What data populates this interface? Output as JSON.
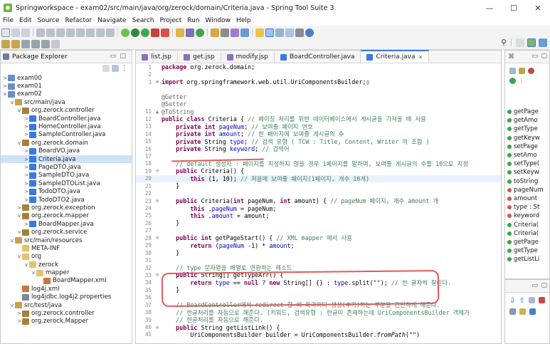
{
  "window": {
    "title": "Springworkspace - exam02/src/main/java/org/zerock/domain/Criteria.java - Spring Tool Suite 3",
    "controls": [
      "—",
      "☐",
      "✕"
    ]
  },
  "menu": [
    "File",
    "Edit",
    "Source",
    "Refactor",
    "Navigate",
    "Search",
    "Project",
    "Run",
    "Window",
    "Help"
  ],
  "package_explorer": {
    "title": "Package Explorer",
    "tree": [
      {
        "indent": 0,
        "twisty": ">",
        "icon": "project",
        "label": "exam00"
      },
      {
        "indent": 0,
        "twisty": ">",
        "icon": "project",
        "label": "exam01"
      },
      {
        "indent": 0,
        "twisty": "v",
        "icon": "project",
        "label": "exam02"
      },
      {
        "indent": 1,
        "twisty": "v",
        "icon": "srcfolder",
        "label": "src/main/java"
      },
      {
        "indent": 2,
        "twisty": "v",
        "icon": "package",
        "label": "org.zerock.controller"
      },
      {
        "indent": 3,
        "twisty": ">",
        "icon": "java",
        "label": "BoardController.java"
      },
      {
        "indent": 3,
        "twisty": ">",
        "icon": "java",
        "label": "HomeController.java"
      },
      {
        "indent": 3,
        "twisty": ">",
        "icon": "java",
        "label": "SampleController.java"
      },
      {
        "indent": 2,
        "twisty": "v",
        "icon": "package",
        "label": "org.zerock.domain"
      },
      {
        "indent": 3,
        "twisty": ">",
        "icon": "java",
        "label": "BoardVO.java"
      },
      {
        "indent": 3,
        "twisty": ">",
        "icon": "java",
        "label": "Criteria.java",
        "selected": true
      },
      {
        "indent": 3,
        "twisty": ">",
        "icon": "java",
        "label": "PageDTO.java"
      },
      {
        "indent": 3,
        "twisty": ">",
        "icon": "java",
        "label": "SampleDTO.java"
      },
      {
        "indent": 3,
        "twisty": ">",
        "icon": "java",
        "label": "SampleDTOList.java"
      },
      {
        "indent": 3,
        "twisty": ">",
        "icon": "java",
        "label": "TodoDTO.java"
      },
      {
        "indent": 3,
        "twisty": ">",
        "icon": "java",
        "label": "TodoDTO2.java"
      },
      {
        "indent": 2,
        "twisty": ">",
        "icon": "package",
        "label": "org.zerock.exception"
      },
      {
        "indent": 2,
        "twisty": "v",
        "icon": "package",
        "label": "org.zerock.mapper"
      },
      {
        "indent": 3,
        "twisty": ">",
        "icon": "java",
        "label": "BoardMapper.java"
      },
      {
        "indent": 2,
        "twisty": ">",
        "icon": "package",
        "label": "org.zerock.service"
      },
      {
        "indent": 1,
        "twisty": "v",
        "icon": "srcfolder",
        "label": "src/main/resources"
      },
      {
        "indent": 2,
        "twisty": "",
        "icon": "folder",
        "label": "META-INF"
      },
      {
        "indent": 2,
        "twisty": "v",
        "icon": "folder",
        "label": "org"
      },
      {
        "indent": 3,
        "twisty": "v",
        "icon": "folder",
        "label": "zerock"
      },
      {
        "indent": 4,
        "twisty": "v",
        "icon": "folder",
        "label": "mapper"
      },
      {
        "indent": 5,
        "twisty": "",
        "icon": "xml",
        "label": "BoardMapper.xml"
      },
      {
        "indent": 2,
        "twisty": "",
        "icon": "xml",
        "label": "log4j.xml"
      },
      {
        "indent": 2,
        "twisty": "",
        "icon": "props",
        "label": "log4jdbc.log4j2.properties"
      },
      {
        "indent": 1,
        "twisty": "v",
        "icon": "srcfolder",
        "label": "src/test/java"
      },
      {
        "indent": 2,
        "twisty": ">",
        "icon": "package",
        "label": "org.zerock.controller"
      },
      {
        "indent": 2,
        "twisty": ">",
        "icon": "package",
        "label": "org.zerock.Mapper"
      }
    ]
  },
  "editor": {
    "tabs": [
      {
        "label": "list.jsp",
        "icon": "jsp"
      },
      {
        "label": "get.jsp",
        "icon": "jsp"
      },
      {
        "label": "modify.jsp",
        "icon": "jsp"
      },
      {
        "label": "BoardController.java",
        "icon": "java"
      },
      {
        "label": "Criteria.java",
        "icon": "java",
        "active": true
      }
    ],
    "lines": [
      {
        "n": "1",
        "fold": "",
        "segs": [
          [
            "kw",
            "package"
          ],
          [
            "",
            "org.zerock.domain;"
          ]
        ]
      },
      {
        "n": "2",
        "fold": "",
        "segs": []
      },
      {
        "n": "3",
        "fold": "⊕",
        "segs": [
          [
            "kw",
            "import"
          ],
          [
            "",
            "org.springframework.web.util.UriComponentsBuilder;▯"
          ]
        ]
      },
      {
        "n": "",
        "fold": "",
        "segs": []
      },
      {
        "n": "",
        "fold": "",
        "segs": [
          [
            "an",
            "@Getter"
          ]
        ]
      },
      {
        "n": "",
        "fold": "",
        "segs": [
          [
            "an",
            "@Setter"
          ]
        ]
      },
      {
        "n": "11",
        "fold": "▲",
        "segs": [
          [
            "an",
            "@ToString"
          ]
        ]
      },
      {
        "n": "12",
        "fold": "",
        "segs": [
          [
            "kw",
            "public class"
          ],
          [
            "",
            "Criteria { "
          ],
          [
            "cm",
            "// 페이징 처리를 위한 데이터베이스에서 게시글을 가져올 때 사용"
          ]
        ]
      },
      {
        "n": "13",
        "fold": "",
        "segs": [
          [
            "",
            "    "
          ],
          [
            "kw",
            "private int"
          ],
          [
            "fd",
            "pageNum"
          ],
          [
            "",
            "; "
          ],
          [
            "cm",
            "// 보여줄 페이지 번호"
          ]
        ]
      },
      {
        "n": "14",
        "fold": "",
        "segs": [
          [
            "",
            "    "
          ],
          [
            "kw",
            "private int"
          ],
          [
            "fd",
            "amount"
          ],
          [
            "",
            "; "
          ],
          [
            "cm",
            "// 한 페이지에 보여줄 게시글의 수"
          ]
        ]
      },
      {
        "n": "15",
        "fold": "",
        "segs": [
          [
            "",
            "    "
          ],
          [
            "kw",
            "private"
          ],
          [
            "",
            "String "
          ],
          [
            "fd",
            "type"
          ],
          [
            "",
            "; "
          ],
          [
            "cm",
            "// 검색 유형 ( TCW : Title, Content, Writer 의 조합 )"
          ]
        ]
      },
      {
        "n": "16",
        "fold": "",
        "segs": [
          [
            "",
            "    "
          ],
          [
            "kw",
            "private"
          ],
          [
            "",
            "String "
          ],
          [
            "fd",
            "keyword"
          ],
          [
            "",
            "; "
          ],
          [
            "cm",
            "// 검색어"
          ]
        ]
      },
      {
        "n": "17",
        "fold": "",
        "segs": []
      },
      {
        "n": "18",
        "fold": "",
        "segs": [
          [
            "",
            "    "
          ],
          [
            "cm",
            "// default 생성자 : 페이지를 지정하지 않을 경우 1페이지를 말하며, 보여줄 게시글의 수를 10으로 지정"
          ]
        ]
      },
      {
        "n": "19",
        "fold": "⊖",
        "segs": [
          [
            "",
            "    "
          ],
          [
            "kw",
            "public"
          ],
          [
            "",
            "Criteria() {"
          ]
        ]
      },
      {
        "n": "20",
        "fold": "",
        "hl": true,
        "segs": [
          [
            "",
            "        "
          ],
          [
            "kw",
            "this"
          ],
          [
            "",
            "(1, 10); "
          ],
          [
            "cm",
            "// 처음에 보여줄 페이지(1페이지, 개수 10개)"
          ]
        ]
      },
      {
        "n": "21",
        "fold": "",
        "segs": [
          [
            "",
            "    }"
          ]
        ]
      },
      {
        "n": "22",
        "fold": "",
        "segs": []
      },
      {
        "n": "23",
        "fold": "⊖",
        "segs": [
          [
            "",
            "    "
          ],
          [
            "kw",
            "public"
          ],
          [
            "",
            "Criteria("
          ],
          [
            "kw",
            "int"
          ],
          [
            "",
            "pageNum, "
          ],
          [
            "kw",
            "int"
          ],
          [
            "",
            "amount) { "
          ],
          [
            "cm",
            "// pageNum 페이지, 개수 amount 개"
          ]
        ]
      },
      {
        "n": "24",
        "fold": "",
        "segs": [
          [
            "",
            "        "
          ],
          [
            "kw",
            "this"
          ],
          [
            ".",
            ""
          ],
          [
            "fd",
            "pageNum"
          ],
          [
            "",
            "= pageNum;"
          ]
        ]
      },
      {
        "n": "25",
        "fold": "",
        "segs": [
          [
            "",
            "        "
          ],
          [
            "kw",
            "this"
          ],
          [
            ".",
            ""
          ],
          [
            "fd",
            "amount"
          ],
          [
            "",
            "= amount;"
          ]
        ]
      },
      {
        "n": "26",
        "fold": "",
        "segs": [
          [
            "",
            "    }"
          ]
        ]
      },
      {
        "n": "27",
        "fold": "",
        "segs": []
      },
      {
        "n": "28",
        "fold": "⊖",
        "segs": [
          [
            "",
            "    "
          ],
          [
            "kw",
            "public int"
          ],
          [
            "",
            "getPageStart() { "
          ],
          [
            "cm",
            "// XML mapper 에서 사용"
          ]
        ]
      },
      {
        "n": "29",
        "fold": "",
        "segs": [
          [
            "",
            "        "
          ],
          [
            "kw",
            "return"
          ],
          [
            "",
            "("
          ],
          [
            "fd",
            "pageNum"
          ],
          [
            "",
            "-1) * "
          ],
          [
            "fd",
            "amount"
          ],
          [
            "",
            ";"
          ]
        ]
      },
      {
        "n": "30",
        "fold": "",
        "segs": [
          [
            "",
            "    }"
          ]
        ]
      },
      {
        "n": "31",
        "fold": "",
        "segs": []
      },
      {
        "n": "32",
        "fold": "",
        "segs": [
          [
            "",
            "    "
          ],
          [
            "cm",
            "// type 문자열을 배열로 변환하는 메소드"
          ]
        ]
      },
      {
        "n": "33",
        "fold": "⊖",
        "segs": [
          [
            "",
            "    "
          ],
          [
            "kw",
            "public"
          ],
          [
            "",
            "String[] getTypeArr() {"
          ]
        ]
      },
      {
        "n": "34",
        "fold": "",
        "segs": [
          [
            "",
            "        "
          ],
          [
            "kw",
            "return"
          ],
          [
            "fd",
            "type"
          ],
          [
            "",
            "== "
          ],
          [
            "kw",
            "null"
          ],
          [
            "",
            "? "
          ],
          [
            "kw",
            "new"
          ],
          [
            "",
            "String[] {} : "
          ],
          [
            "fd",
            "type"
          ],
          [
            "",
            ".split("
          ],
          [
            "st",
            "\"\""
          ],
          [
            "",
            "); "
          ],
          [
            "cm",
            "// 한 글자씩 잘린다."
          ]
        ]
      },
      {
        "n": "35",
        "fold": "",
        "segs": [
          [
            "",
            "    }"
          ]
        ]
      },
      {
        "n": "36",
        "fold": "",
        "segs": []
      },
      {
        "n": "37",
        "fold": "",
        "segs": [
          [
            "",
            "    "
          ],
          [
            "cm",
            "// BoardController에서 redirect 할 때 파라미터 생성(추가)하는 부분을 간단하게 해준다."
          ]
        ]
      },
      {
        "n": "38",
        "fold": "",
        "segs": [
          [
            "",
            "    "
          ],
          [
            "cm",
            "// 한글처리를 자동으로 해준다. (키워드, 검색유형 : 한글이 존재하는데 UriComponentsBuilder 객체가"
          ]
        ]
      },
      {
        "n": "39",
        "fold": "",
        "segs": [
          [
            "",
            "    "
          ],
          [
            "cm",
            "// 한글처리를 자동으로 해준다."
          ]
        ]
      },
      {
        "n": "40",
        "fold": "⊖",
        "segs": [
          [
            "",
            "    "
          ],
          [
            "kw",
            "public"
          ],
          [
            "",
            "String getListLink() {"
          ]
        ]
      },
      {
        "n": "41",
        "fold": "",
        "segs": [
          [
            "",
            "        UriComponentsBuilder builder = UriComponentsBuilder."
          ],
          [
            "it",
            "fromPath"
          ],
          [
            "",
            "(\"\")"
          ]
        ]
      }
    ]
  },
  "outline": {
    "items": [
      {
        "label": "getPage",
        "color": "#3aa34a"
      },
      {
        "label": "getAmo",
        "color": "#3aa34a"
      },
      {
        "label": "getType",
        "color": "#3aa34a"
      },
      {
        "label": "getKeyw",
        "color": "#3aa34a"
      },
      {
        "label": "setPage",
        "color": "#3aa34a"
      },
      {
        "label": "setAmo",
        "color": "#3aa34a"
      },
      {
        "label": "setType(",
        "color": "#3aa34a"
      },
      {
        "label": "setKeyw",
        "color": "#3aa34a"
      },
      {
        "label": "toString",
        "color": "#3aa34a"
      },
      {
        "label": "pageNum",
        "color": "#c85a5a"
      },
      {
        "label": "amount",
        "color": "#c85a5a"
      },
      {
        "label": "type : St",
        "color": "#c85a5a"
      },
      {
        "label": "keyword",
        "color": "#c85a5a"
      },
      {
        "label": "Criteria(",
        "color": "#3aa34a"
      },
      {
        "label": "Criteria(",
        "color": "#3aa34a"
      },
      {
        "label": "getPage",
        "color": "#3aa34a"
      },
      {
        "label": "getType",
        "color": "#3aa34a"
      },
      {
        "label": "getListLi",
        "color": "#3aa34a"
      }
    ]
  },
  "colors": {
    "accent": "#3b78e7",
    "selection": "#cfe3f7",
    "annotation": "#e15a5a",
    "keyword": "#7f0055",
    "comment": "#3f7f5f",
    "field": "#0000c0"
  }
}
